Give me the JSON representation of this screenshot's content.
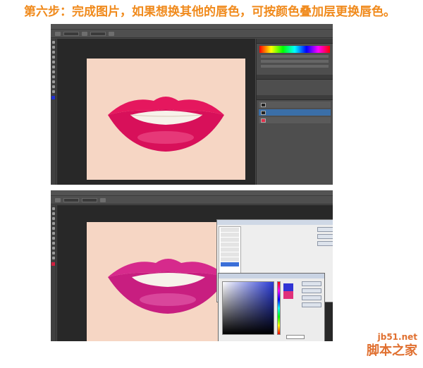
{
  "heading": "第六步：完成图片，如果想换其他的唇色，可按颜色叠加层更换唇色。",
  "watermark": {
    "url": "jb51.net",
    "name": "脚本之家"
  },
  "colors": {
    "accent_text": "#f08a1c",
    "lip_before": "#e5175e",
    "lip_after": "#d62a8c",
    "overlay_color": "#3034d4"
  },
  "icons": {
    "toolbox": "tool-icon",
    "layer_visibility": "eye-icon",
    "color_swatch": "color-swatch-icon"
  }
}
